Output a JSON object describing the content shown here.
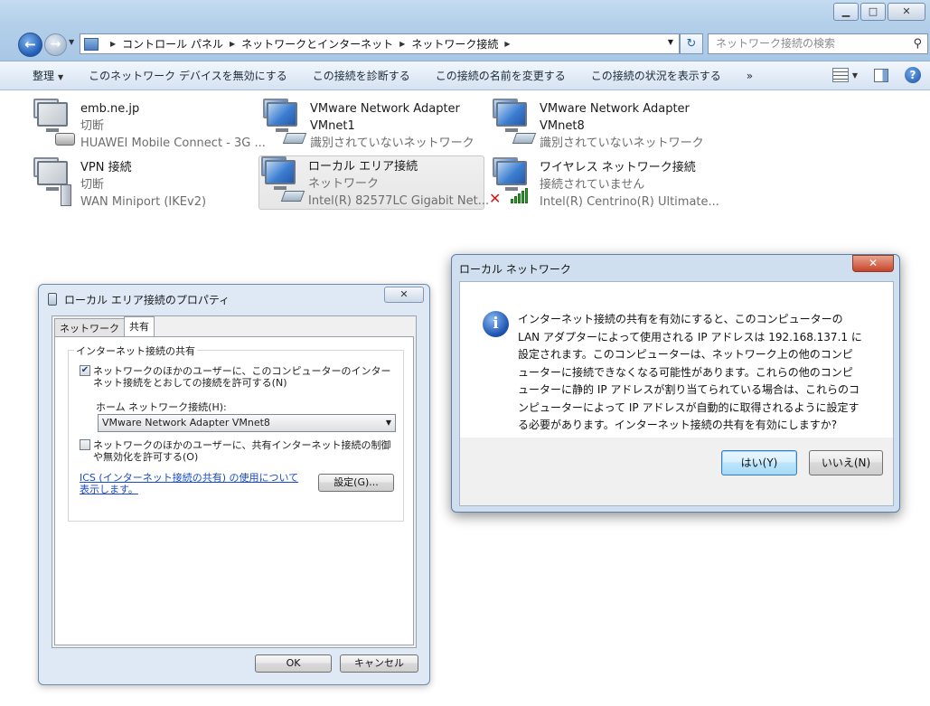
{
  "window": {
    "minimize": "▁",
    "maximize": "□",
    "close": "✕"
  },
  "address": {
    "crumbs": [
      "コントロール パネル",
      "ネットワークとインターネット",
      "ネットワーク接続"
    ],
    "search_placeholder": "ネットワーク接続の検索"
  },
  "toolbar": {
    "organize": "整理",
    "items": [
      "このネットワーク デバイスを無効にする",
      "この接続を診断する",
      "この接続の名前を変更する",
      "この接続の状況を表示する"
    ],
    "more": "»"
  },
  "connections": [
    {
      "name": "emb.ne.jp",
      "status": "切断",
      "device": "HUAWEI Mobile Connect - 3G ..."
    },
    {
      "name": "VMware Network Adapter VMnet1",
      "name_line1": "VMware Network Adapter",
      "name_line2": "VMnet1",
      "status": "識別されていないネットワーク"
    },
    {
      "name": "VMware Network Adapter VMnet8",
      "name_line1": "VMware Network Adapter",
      "name_line2": "VMnet8",
      "status": "識別されていないネットワーク"
    },
    {
      "name": "VPN 接続",
      "status": "切断",
      "device": "WAN Miniport (IKEv2)"
    },
    {
      "name": "ローカル エリア接続",
      "status": "ネットワーク",
      "device": "Intel(R) 82577LC Gigabit Net..."
    },
    {
      "name": "ワイヤレス ネットワーク接続",
      "status": "接続されていません",
      "device": "Intel(R) Centrino(R) Ultimate..."
    }
  ],
  "props_dialog": {
    "title": "ローカル エリア接続のプロパティ",
    "tabs": [
      "ネットワーク",
      "共有"
    ],
    "group_label": "インターネット接続の共有",
    "allow_share": {
      "checked": true,
      "label": "ネットワークのほかのユーザーに、このコンピューターのインターネット接続をとおしての接続を許可する(N)"
    },
    "home_network_label": "ホーム ネットワーク接続(H):",
    "home_network_value": "VMware Network Adapter VMnet8",
    "allow_control": {
      "checked": false,
      "label": "ネットワークのほかのユーザーに、共有インターネット接続の制御や無効化を許可する(O)"
    },
    "ics_link": "ICS (インターネット接続の共有) の使用について表示します。",
    "settings_button": "設定(G)...",
    "ok_button": "OK",
    "cancel_button": "キャンセル"
  },
  "message_dialog": {
    "title": "ローカル ネットワーク",
    "close": "✕",
    "icon_glyph": "i",
    "lines": [
      "インターネット接続の共有を有効にすると、このコンピューターの",
      "LAN アダプターによって使用される IP アドレスは 192.168.137.1 に",
      "設定されます。このコンピューターは、ネットワーク上の他のコンピ",
      "ューターに接続できなくなる可能性があります。これらの他のコンピ",
      "ューターに静的 IP アドレスが割り当てられている場合は、これらのコ",
      "ンピューターによって IP アドレスが自動的に取得されるように設定す",
      "る必要があります。インターネット接続の共有を有効にしますか?"
    ],
    "yes_button": "はい(Y)",
    "no_button": "いいえ(N)"
  }
}
